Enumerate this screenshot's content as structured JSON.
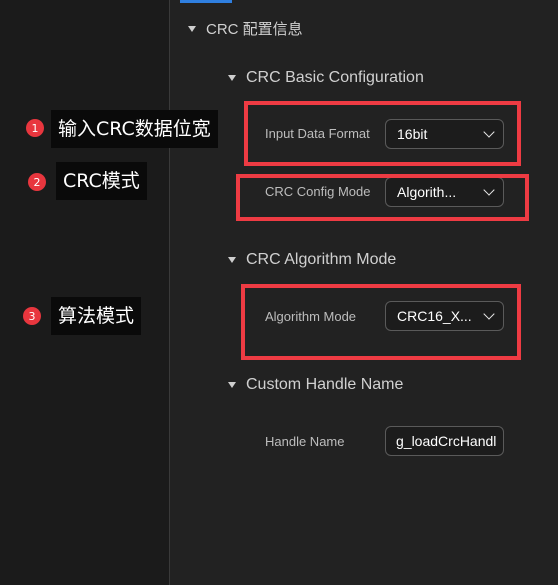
{
  "panel": {
    "top_section_title": "CRC 配置信息"
  },
  "basic_config": {
    "title": "CRC Basic Configuration",
    "input_data_format_label": "Input Data Format",
    "input_data_format_value": "16bit",
    "crc_config_mode_label": "CRC Config Mode",
    "crc_config_mode_value": "Algorith..."
  },
  "algorithm_mode": {
    "title": "CRC Algorithm Mode",
    "label": "Algorithm Mode",
    "value": "CRC16_X..."
  },
  "custom_handle": {
    "title": "Custom Handle Name",
    "label": "Handle Name",
    "value": "g_loadCrcHandle"
  },
  "annotations": [
    {
      "number": "1",
      "text": "输入CRC数据位宽"
    },
    {
      "number": "2",
      "text": "CRC模式"
    },
    {
      "number": "3",
      "text": "算法模式"
    }
  ],
  "colors": {
    "highlight_box": "#ee3b43",
    "badge": "#e8363e",
    "accent_tab": "#2f7fe0"
  }
}
